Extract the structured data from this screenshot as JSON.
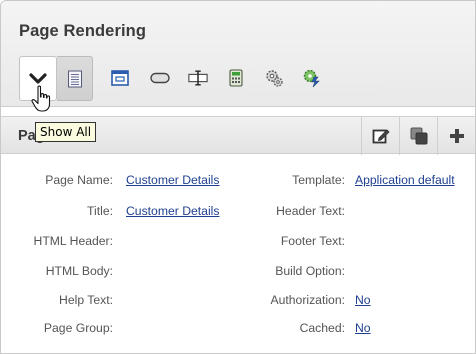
{
  "panel": {
    "title": "Page Rendering"
  },
  "toolbar": {
    "buttons": [
      {
        "name": "show-all-button",
        "icon": "chevron-down-icon"
      },
      {
        "name": "document-view-button",
        "icon": "document-icon"
      },
      {
        "name": "region-view-button",
        "icon": "window-icon"
      },
      {
        "name": "button-view-button",
        "icon": "pill-button-icon"
      },
      {
        "name": "item-view-button",
        "icon": "text-cursor-icon"
      },
      {
        "name": "computation-view-button",
        "icon": "calculator-icon"
      },
      {
        "name": "process-view-button",
        "icon": "gears-icon"
      },
      {
        "name": "dynamic-action-view-button",
        "icon": "gear-lightning-icon"
      }
    ]
  },
  "tooltip": {
    "text": "Show All"
  },
  "region": {
    "title": "Page",
    "actions": [
      {
        "name": "edit-button",
        "icon": "edit-icon"
      },
      {
        "name": "copy-button",
        "icon": "copy-icon"
      },
      {
        "name": "create-button",
        "icon": "plus-icon"
      }
    ]
  },
  "properties": {
    "left": [
      {
        "label": "Page Name:",
        "value": "Customer Details",
        "link": true
      },
      {
        "label": "Title:",
        "value": "Customer Details",
        "link": true
      },
      {
        "label": "HTML Header:",
        "value": "",
        "link": false
      },
      {
        "label": "HTML Body:",
        "value": "",
        "link": false
      },
      {
        "label": "Help Text:",
        "value": "",
        "link": false
      },
      {
        "label": "Page Group:",
        "value": "",
        "link": false
      }
    ],
    "right": [
      {
        "label": "Template:",
        "value": "Application default",
        "link": true
      },
      {
        "label": "Header Text:",
        "value": "",
        "link": false
      },
      {
        "label": "Footer Text:",
        "value": "",
        "link": false
      },
      {
        "label": "Build Option:",
        "value": "",
        "link": false
      },
      {
        "label": "Authorization:",
        "value": "No",
        "link": true
      },
      {
        "label": "Cached:",
        "value": "No",
        "link": true
      }
    ]
  },
  "colors": {
    "link": "#1f3f8f",
    "header_bg": "#ececec",
    "tooltip_bg": "#fbfbe0"
  }
}
